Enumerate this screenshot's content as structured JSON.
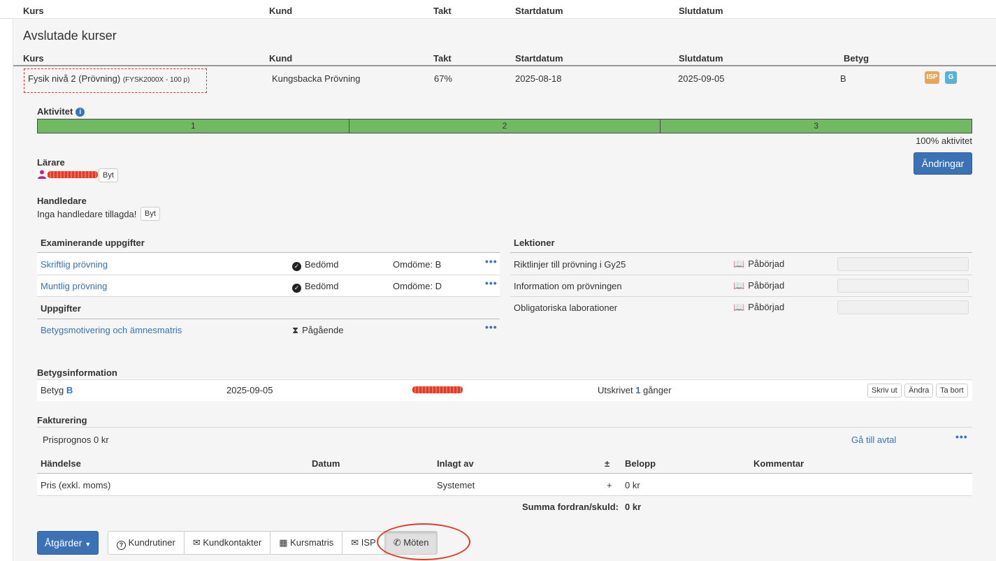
{
  "top_header": {
    "cols": [
      "Kurs",
      "Kund",
      "Takt",
      "Startdatum",
      "Slutdatum"
    ]
  },
  "section": {
    "title": "Avslutade kurser"
  },
  "course_table": {
    "cols": [
      "Kurs",
      "Kund",
      "Takt",
      "Startdatum",
      "Slutdatum",
      "Betyg"
    ],
    "row": {
      "name": "Fysik nivå 2 (Prövning)",
      "code": "(FYSK2000X - 100 p)",
      "customer": "Kungsbacka Prövning",
      "pace": "67%",
      "start": "2025-08-18",
      "end": "2025-09-05",
      "grade": "B",
      "badges": [
        "ISP",
        "G"
      ]
    }
  },
  "activity": {
    "label": "Aktivitet",
    "info_icon": "i",
    "segments": [
      "1",
      "2",
      "3"
    ],
    "percent": 100,
    "summary": "100% aktivitet"
  },
  "teacher": {
    "label": "Lärare",
    "change_label": "Byt"
  },
  "changes_button": "Ändringar",
  "supervisor": {
    "label": "Handledare",
    "empty": "Inga handledare tillagda!",
    "change_label": "Byt"
  },
  "exam_tasks": {
    "title": "Examinerande uppgifter",
    "rows": [
      {
        "name": "Skriftlig prövning",
        "status": "Bedömd",
        "assessment": "Omdöme: B"
      },
      {
        "name": "Muntlig prövning",
        "status": "Bedömd",
        "assessment": "Omdöme: D"
      }
    ]
  },
  "tasks": {
    "title": "Uppgifter",
    "rows": [
      {
        "name": "Betygsmotivering och ämnesmatris",
        "status": "Pågående"
      }
    ]
  },
  "lessons": {
    "title": "Lektioner",
    "rows": [
      {
        "name": "Riktlinjer till prövning i Gy25",
        "status": "Påbörjad"
      },
      {
        "name": "Information om prövningen",
        "status": "Påbörjad"
      },
      {
        "name": "Obligatoriska laborationer",
        "status": "Påbörjad"
      }
    ]
  },
  "grade_info": {
    "title": "Betygsinformation",
    "grade_prefix": "Betyg",
    "grade": "B",
    "date": "2025-09-05",
    "printed_prefix": "Utskrivet",
    "printed_count": "1",
    "printed_suffix": "gånger",
    "print_btn": "Skriv ut",
    "edit_btn": "Ändra",
    "delete_btn": "Ta bort"
  },
  "billing": {
    "title": "Fakturering",
    "forecast": "Prisprognos 0 kr",
    "agreement_link": "Gå till avtal",
    "cols": [
      "Händelse",
      "Datum",
      "Inlagt av",
      "±",
      "Belopp",
      "Kommentar"
    ],
    "rows": [
      {
        "event": "Pris (exkl. moms)",
        "date": "",
        "by": "Systemet",
        "sign": "+",
        "amount": "0 kr",
        "comment": ""
      }
    ],
    "sum_label": "Summa fordran/skuld:",
    "sum_value": "0 kr"
  },
  "actions": {
    "dropdown": "Åtgärder",
    "buttons": [
      {
        "label": "Kundrutiner",
        "icon": "question-circle-icon"
      },
      {
        "label": "Kundkontakter",
        "icon": "envelope-icon"
      },
      {
        "label": "Kursmatris",
        "icon": "grid-icon"
      },
      {
        "label": "ISP",
        "icon": "envelope-icon"
      },
      {
        "label": "Möten",
        "icon": "phone-icon"
      }
    ]
  },
  "colors": {
    "primary": "#3a72b5",
    "progress": "#72b963",
    "badge_isp": "#e5a65a",
    "badge_g": "#5bb0d8",
    "annotation": "#e23b2a"
  }
}
